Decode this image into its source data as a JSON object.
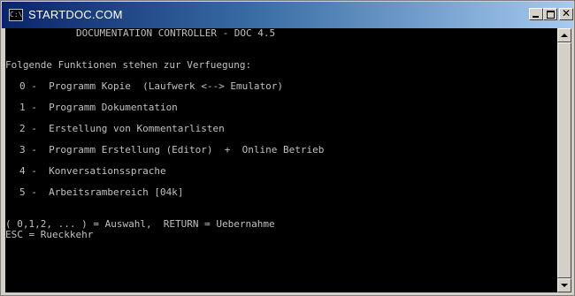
{
  "window": {
    "title": "STARTDOC.COM",
    "icon_text": "C:\\",
    "icon": "console-icon",
    "buttons": {
      "minimize": "minimize-icon",
      "maximize": "maximize-icon",
      "close": "close-icon",
      "close_glyph": "✕"
    }
  },
  "console": {
    "header": "DOCUMENTATION CONTROLLER - DOC 4.5",
    "intro": "Folgende Funktionen stehen zur Verfuegung:",
    "menu": [
      "0 -  Programm Kopie  (Laufwerk <--> Emulator)",
      "1 -  Programm Dokumentation",
      "2 -  Erstellung von Kommentarlisten",
      "3 -  Programm Erstellung (Editor)  +  Online Betrieb",
      "4 -  Konversationssprache",
      "5 -  Arbeitsrambereich [04k]"
    ],
    "prompt_line1": "( 0,1,2, ... ) = Auswahl,  RETURN = Uebernahme",
    "prompt_line2": "ESC = Rueckkehr"
  },
  "colors": {
    "console_background": "#000000",
    "console_text": "#c0c0c0",
    "titlebar_start": "#0a246a",
    "titlebar_end": "#a6caf0"
  }
}
